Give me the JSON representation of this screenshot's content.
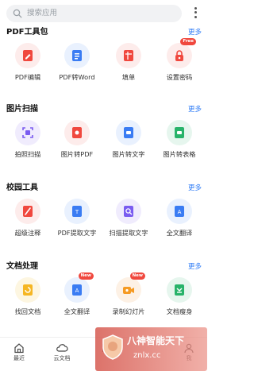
{
  "search": {
    "placeholder": "搜索应用"
  },
  "sections": [
    {
      "title": "PDF工具包",
      "more": "更多",
      "tools": [
        {
          "label": "PDF编辑",
          "icon": "pdf-edit-icon"
        },
        {
          "label": "PDF转Word",
          "icon": "pdf-to-word-icon"
        },
        {
          "label": "填单",
          "icon": "fill-form-icon"
        },
        {
          "label": "设置密码",
          "icon": "lock-icon",
          "badge": "Free"
        }
      ]
    },
    {
      "title": "图片扫描",
      "more": "更多",
      "tools": [
        {
          "label": "拍照扫描",
          "icon": "scan-icon"
        },
        {
          "label": "图片转PDF",
          "icon": "image-to-pdf-icon"
        },
        {
          "label": "图片转文字",
          "icon": "image-to-text-icon"
        },
        {
          "label": "图片转表格",
          "icon": "image-to-table-icon"
        }
      ]
    },
    {
      "title": "校园工具",
      "more": "更多",
      "tools": [
        {
          "label": "超级注释",
          "icon": "annotate-icon"
        },
        {
          "label": "PDF提取文字",
          "icon": "pdf-extract-text-icon"
        },
        {
          "label": "扫描提取文字",
          "icon": "scan-extract-text-icon"
        },
        {
          "label": "全文翻译",
          "icon": "translate-icon"
        }
      ]
    },
    {
      "title": "文档处理",
      "more": "更多",
      "tools": [
        {
          "label": "找回文档",
          "icon": "recover-doc-icon"
        },
        {
          "label": "全文翻译",
          "icon": "translate-icon",
          "badge": "New"
        },
        {
          "label": "录制幻灯片",
          "icon": "record-slides-icon",
          "badge": "New"
        },
        {
          "label": "文档瘦身",
          "icon": "doc-slim-icon"
        }
      ]
    }
  ],
  "bottom_nav": [
    {
      "label": "最近",
      "icon": "home-icon"
    },
    {
      "label": "云文档",
      "icon": "cloud-icon"
    },
    {
      "label": "",
      "icon": "apps-icon"
    },
    {
      "label": "我",
      "icon": "user-icon"
    }
  ],
  "watermark": {
    "line1": "八神智能天下",
    "line2": "znlx.cc"
  },
  "colors": {
    "accent": "#2f7cf6",
    "red": "#f0483e",
    "blue": "#3a7cf3",
    "purple": "#7a5cf0",
    "orange": "#f59a23",
    "green": "#28b36a"
  }
}
